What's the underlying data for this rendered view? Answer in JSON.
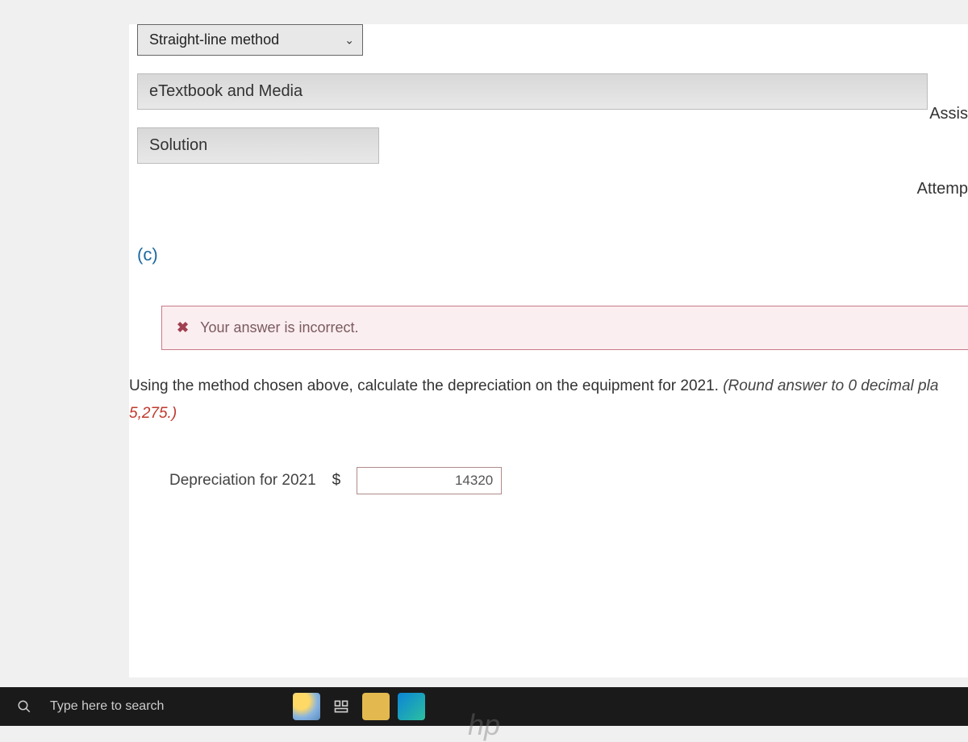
{
  "dropdown": {
    "selected": "Straight-line method"
  },
  "panels": {
    "etextbook": "eTextbook and Media",
    "solution": "Solution"
  },
  "right_side": {
    "assist": "Assis",
    "attempt": "Attemp"
  },
  "part_label": "(c)",
  "feedback": {
    "message": "Your answer is incorrect."
  },
  "question": {
    "main": "Using the method chosen above, calculate the depreciation on the equipment for 2021. ",
    "instruction": "(Round answer to 0 decimal pla",
    "example": "5,275.)"
  },
  "answer": {
    "label": "Depreciation for 2021",
    "currency": "$",
    "value": "14320"
  },
  "taskbar": {
    "search_placeholder": "Type here to search"
  }
}
